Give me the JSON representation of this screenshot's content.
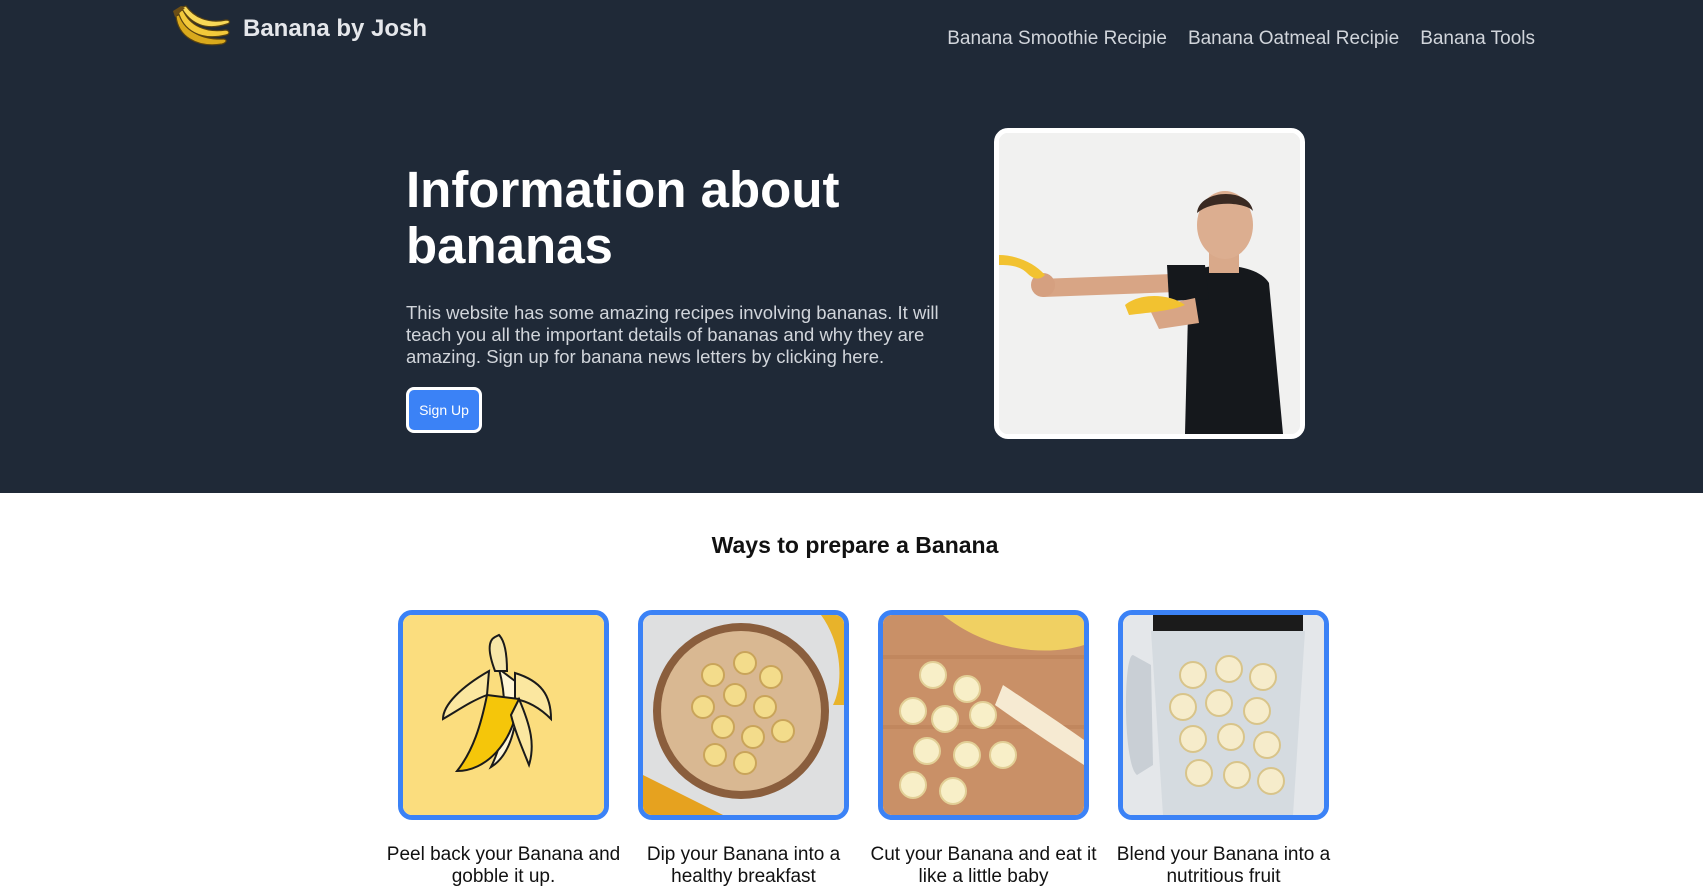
{
  "header": {
    "brand": "Banana by Josh",
    "logo_icon": "banana-bunch-icon",
    "nav": [
      {
        "label": "Banana Smoothie Recipie"
      },
      {
        "label": "Banana Oatmeal Recipie"
      },
      {
        "label": "Banana Tools"
      }
    ]
  },
  "hero": {
    "title": "Information about bananas",
    "description": "This website has some amazing recipes involving bananas. It will teach you all the important details of bananas and why they are amazing. Sign up for banana news letters by clicking here.",
    "button_label": "Sign Up",
    "image_alt": "Man pointing a banana like a gun"
  },
  "section": {
    "title": "Ways to prepare a Banana",
    "cards": [
      {
        "caption": "Peel back your Banana and gobble it up.",
        "image": "peeled-banana-illustration"
      },
      {
        "caption": "Dip your Banana into a healthy breakfast",
        "image": "oatmeal-bowl-photo"
      },
      {
        "caption": "Cut your Banana and eat it like a little baby",
        "image": "sliced-banana-photo"
      },
      {
        "caption": "Blend your Banana into a nutritious fruit",
        "image": "blender-photo"
      }
    ]
  },
  "colors": {
    "hero_bg": "#1f2937",
    "accent": "#3b82f6",
    "banana_yellow": "#f5c542"
  }
}
